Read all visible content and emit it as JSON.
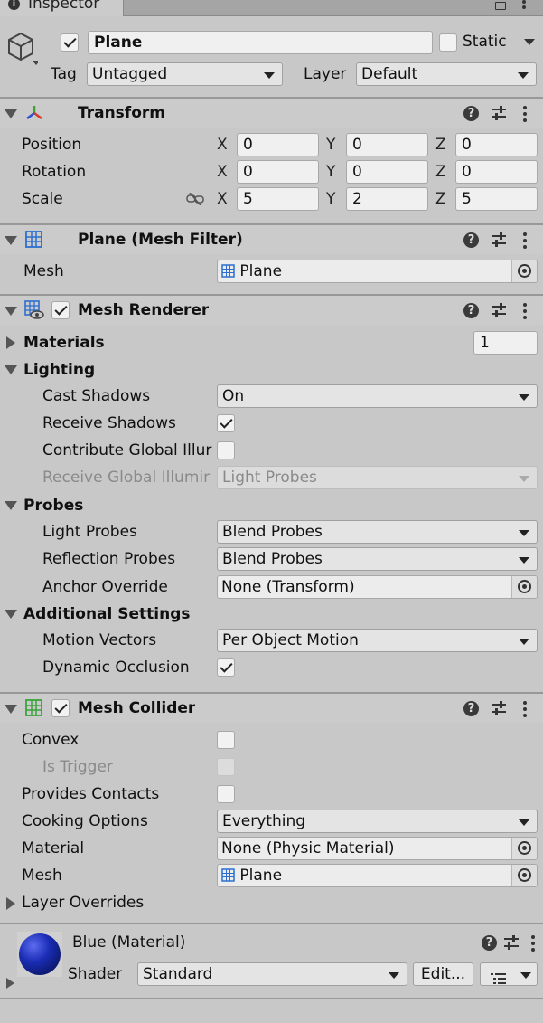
{
  "window": {
    "tab_title": "Inspector"
  },
  "object": {
    "name": "Plane",
    "active": true,
    "static_label": "Static",
    "static": false,
    "tag_label": "Tag",
    "tag_value": "Untagged",
    "layer_label": "Layer",
    "layer_value": "Default"
  },
  "transform": {
    "title": "Transform",
    "position_label": "Position",
    "rotation_label": "Rotation",
    "scale_label": "Scale",
    "position": {
      "x": "0",
      "y": "0",
      "z": "0"
    },
    "rotation": {
      "x": "0",
      "y": "0",
      "z": "0"
    },
    "scale": {
      "x": "5",
      "y": "2",
      "z": "5"
    },
    "axis_x": "X",
    "axis_y": "Y",
    "axis_z": "Z"
  },
  "mesh_filter": {
    "title": "Plane (Mesh Filter)",
    "mesh_label": "Mesh",
    "mesh_value": "Plane"
  },
  "mesh_renderer": {
    "title": "Mesh Renderer",
    "enabled": true,
    "materials_label": "Materials",
    "materials_count": "1",
    "lighting_label": "Lighting",
    "cast_shadows_label": "Cast Shadows",
    "cast_shadows_value": "On",
    "receive_shadows_label": "Receive Shadows",
    "receive_shadows": true,
    "contribute_gi_label": "Contribute Global Illur",
    "contribute_gi": false,
    "receive_gi_label": "Receive Global Illumir",
    "receive_gi_value": "Light Probes",
    "probes_label": "Probes",
    "light_probes_label": "Light Probes",
    "light_probes_value": "Blend Probes",
    "reflection_probes_label": "Reflection Probes",
    "reflection_probes_value": "Blend Probes",
    "anchor_override_label": "Anchor Override",
    "anchor_override_value": "None (Transform)",
    "additional_label": "Additional Settings",
    "motion_vectors_label": "Motion Vectors",
    "motion_vectors_value": "Per Object Motion",
    "dynamic_occlusion_label": "Dynamic Occlusion",
    "dynamic_occlusion": true
  },
  "mesh_collider": {
    "title": "Mesh Collider",
    "enabled": true,
    "convex_label": "Convex",
    "convex": false,
    "is_trigger_label": "Is Trigger",
    "is_trigger": false,
    "provides_contacts_label": "Provides Contacts",
    "provides_contacts": false,
    "cooking_options_label": "Cooking Options",
    "cooking_options_value": "Everything",
    "material_label": "Material",
    "material_value": "None (Physic Material)",
    "mesh_label": "Mesh",
    "mesh_value": "Plane",
    "layer_overrides_label": "Layer Overrides"
  },
  "material": {
    "title": "Blue (Material)",
    "shader_label": "Shader",
    "shader_value": "Standard",
    "edit_label": "Edit...",
    "preview_color": "#1a2db5"
  },
  "colors": {
    "background": "#c8c8c8",
    "header": "#cbcbcb",
    "separator": "#989898",
    "field": "#f0f0f0"
  }
}
